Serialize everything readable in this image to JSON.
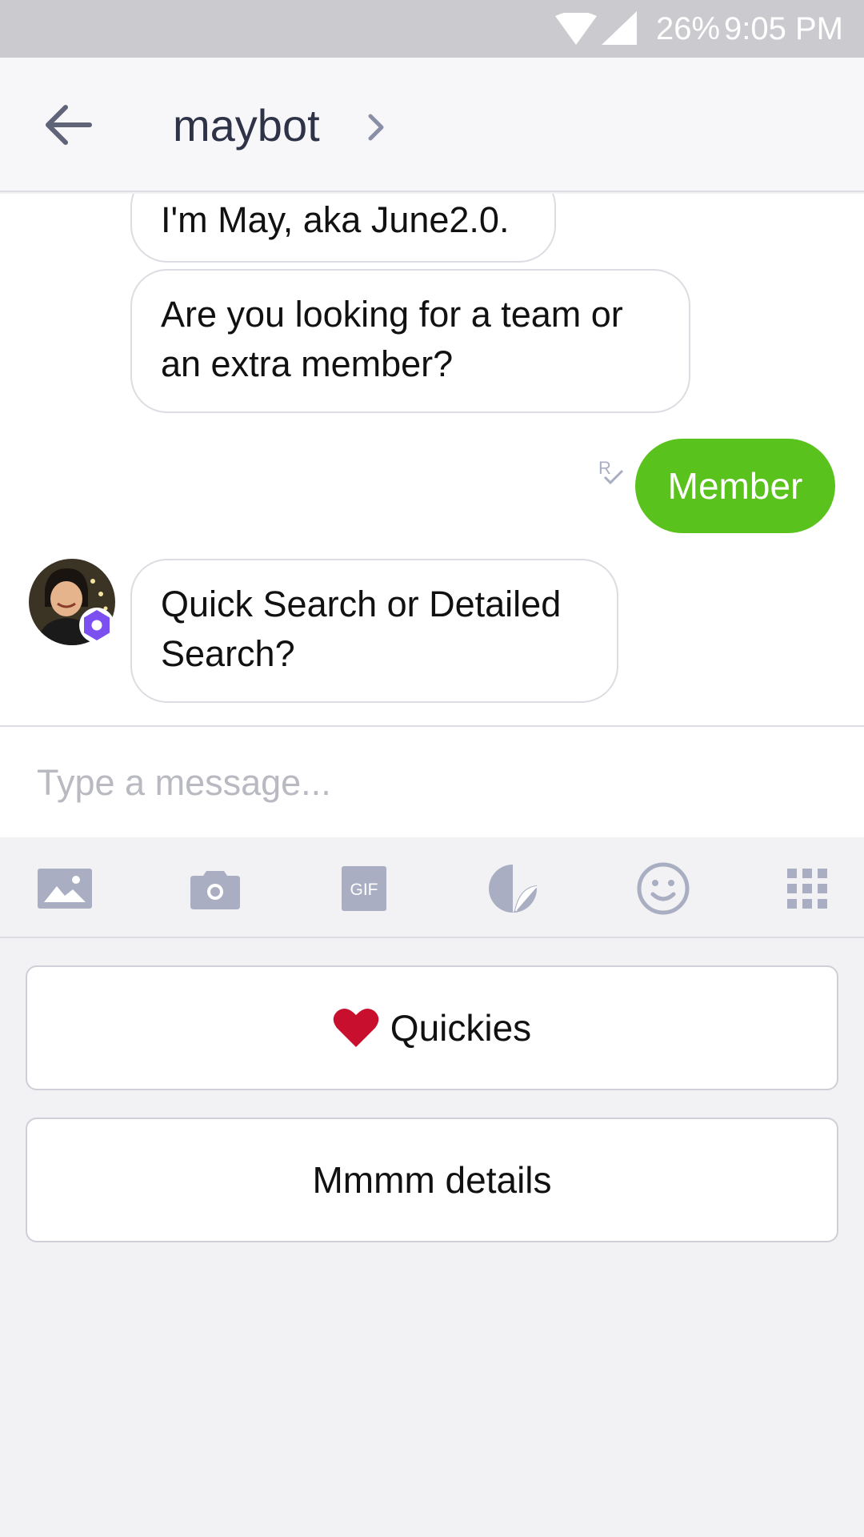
{
  "status_bar": {
    "battery": "26%",
    "time": "9:05 PM"
  },
  "header": {
    "title": "maybot"
  },
  "messages": [
    {
      "from": "bot",
      "text": "I'm May, aka June2.0."
    },
    {
      "from": "bot",
      "text": "Are you looking for a team or an extra member?"
    },
    {
      "from": "user",
      "text": "Member"
    },
    {
      "from": "bot",
      "text": "Quick Search or Detailed Search?"
    }
  ],
  "composer": {
    "placeholder": "Type a message..."
  },
  "toolbar": {
    "items": [
      {
        "icon": "image-icon"
      },
      {
        "icon": "camera-icon"
      },
      {
        "icon": "gif-icon",
        "label": "GIF"
      },
      {
        "icon": "sticker-icon"
      },
      {
        "icon": "emoji-icon"
      },
      {
        "icon": "apps-grid-icon"
      }
    ]
  },
  "quick_replies": [
    {
      "icon": "heart-icon",
      "label": "Quickies"
    },
    {
      "label": "Mmmm details"
    }
  ],
  "colors": {
    "outgoing_bubble": "#5ac21c",
    "badge": "#7b4ff0",
    "icon_gray": "#a9aec2"
  }
}
